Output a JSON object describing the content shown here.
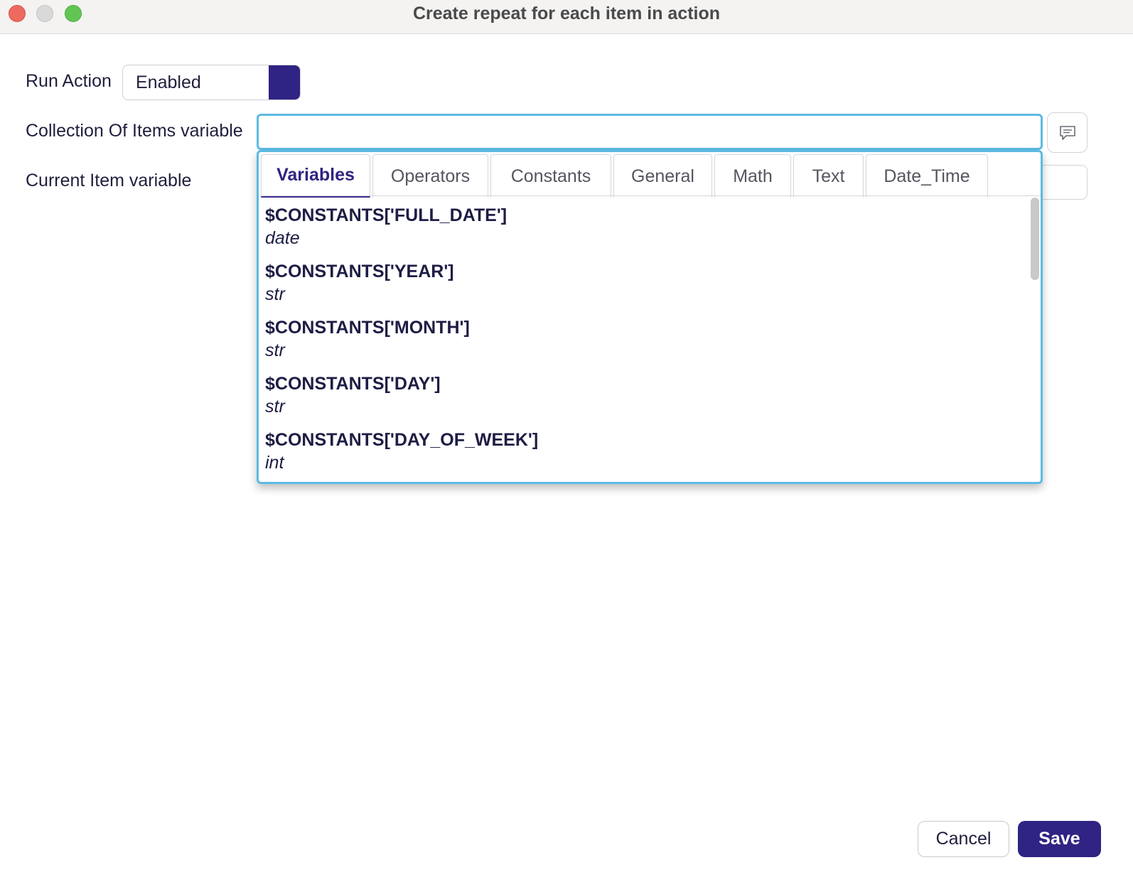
{
  "window": {
    "title": "Create repeat for each item in action"
  },
  "form": {
    "run_action": {
      "label": "Run Action",
      "value": "Enabled"
    },
    "collection": {
      "label": "Collection Of Items variable",
      "value": "",
      "placeholder": ""
    },
    "current_item": {
      "label": "Current Item variable"
    }
  },
  "popup": {
    "tabs": [
      {
        "label": "Variables",
        "active": true
      },
      {
        "label": "Operators",
        "active": false
      },
      {
        "label": "Constants",
        "active": false
      },
      {
        "label": "General",
        "active": false
      },
      {
        "label": "Math",
        "active": false
      },
      {
        "label": "Text",
        "active": false
      },
      {
        "label": "Date_Time",
        "active": false
      }
    ],
    "items": [
      {
        "name": "$CONSTANTS['FULL_DATE']",
        "type": "date"
      },
      {
        "name": "$CONSTANTS['YEAR']",
        "type": "str"
      },
      {
        "name": "$CONSTANTS['MONTH']",
        "type": "str"
      },
      {
        "name": "$CONSTANTS['DAY']",
        "type": "str"
      },
      {
        "name": "$CONSTANTS['DAY_OF_WEEK']",
        "type": "int"
      }
    ]
  },
  "footer": {
    "cancel_label": "Cancel",
    "save_label": "Save"
  },
  "colors": {
    "accent": "#2f2383",
    "focus_border": "#5bbbe3"
  },
  "icons": {
    "comment_button": "comment-icon"
  }
}
